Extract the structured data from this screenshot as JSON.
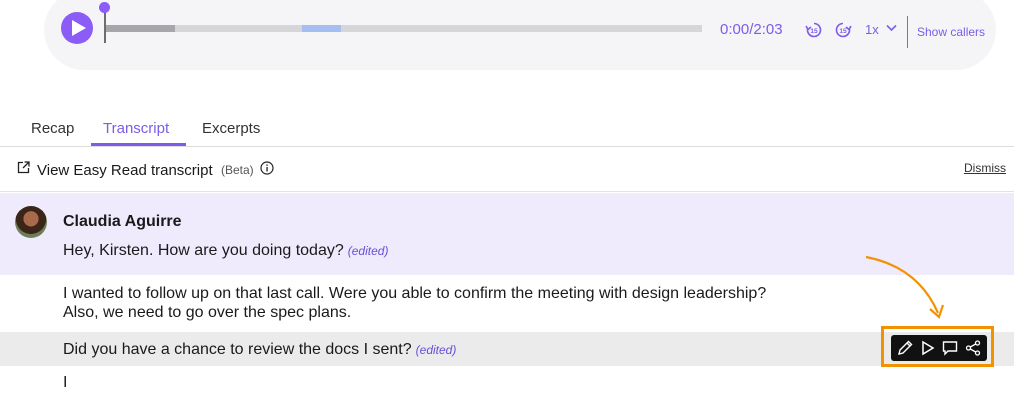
{
  "player": {
    "time": "0:00/2:03",
    "skip_back_label": "15",
    "skip_fwd_label": "15",
    "speed": "1x",
    "show_callers": "Show callers",
    "accent": "#8b5cf6",
    "progress": 0.0
  },
  "tabs": [
    {
      "label": "Recap"
    },
    {
      "label": "Transcript",
      "active": true
    },
    {
      "label": "Excerpts"
    }
  ],
  "easy_read": {
    "label": "View Easy Read transcript",
    "badge": "(Beta)",
    "dismiss": "Dismiss"
  },
  "transcript": {
    "speaker": "Claudia Aguirre",
    "lines": [
      {
        "text": "Hey, Kirsten. How are you doing today?",
        "edited": "(edited)"
      },
      {
        "text": "I wanted to follow up on that last call. Were you able to confirm the meeting with design leadership?",
        "text2": "Also, we need to go over the spec plans."
      },
      {
        "text": "Did you have a chance to review the docs I sent?",
        "edited": "(edited)"
      },
      {
        "text": "I"
      }
    ]
  },
  "toolbar": {
    "icons": [
      "pencil-icon",
      "play-icon",
      "comment-icon",
      "share-icon"
    ],
    "highlight_color": "#f39200"
  }
}
